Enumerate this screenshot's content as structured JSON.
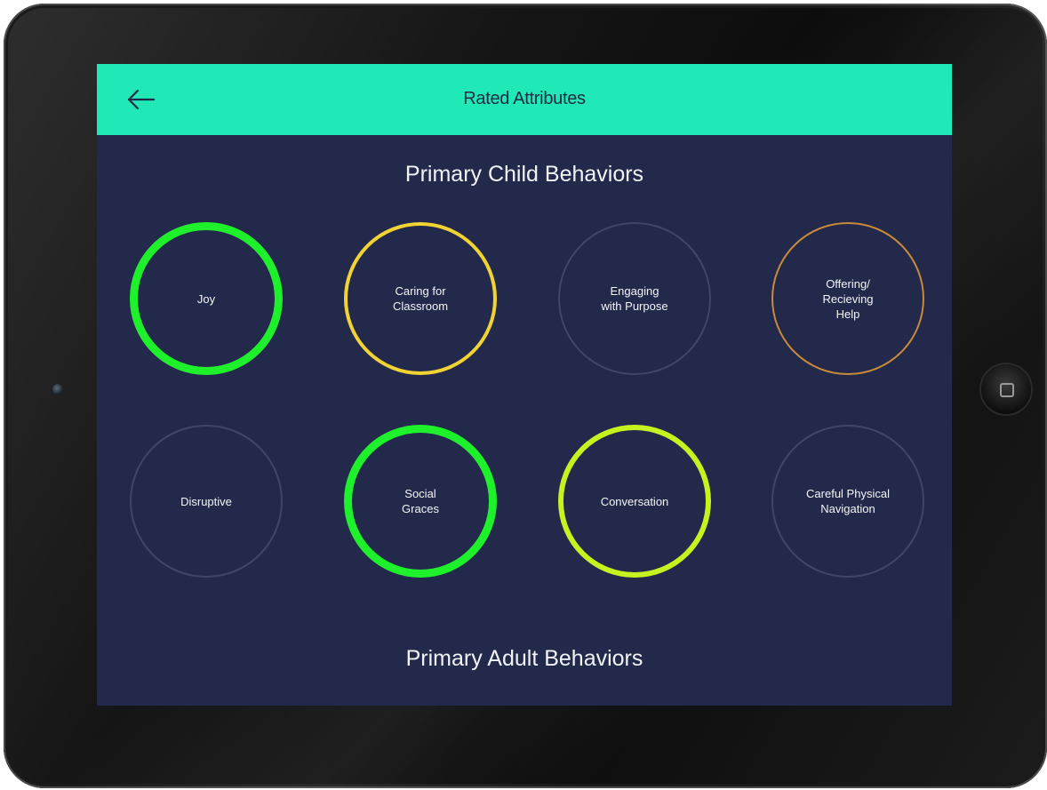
{
  "header": {
    "title": "Rated Attributes",
    "back_icon": "arrow-left-icon",
    "background": "#20e8b6"
  },
  "sections": {
    "child_title": "Primary Child Behaviors",
    "adult_title": "Primary Adult Behaviors"
  },
  "attributes": [
    {
      "name": "attribute-joy",
      "label": "Joy",
      "ring_color": "#1ff02c",
      "ring_width": "thick"
    },
    {
      "name": "attribute-caring-for-classroom",
      "label": "Caring for\nClassroom",
      "ring_color": "#f1d334",
      "ring_width": "medium"
    },
    {
      "name": "attribute-engaging-with-purpose",
      "label": "Engaging\nwith Purpose",
      "ring_color": "#3f4769",
      "ring_width": "thin"
    },
    {
      "name": "attribute-offering-recieving-help",
      "label": "Offering/\nRecieving\nHelp",
      "ring_color": "#c98a3a",
      "ring_width": "thin"
    },
    {
      "name": "attribute-disruptive",
      "label": "Disruptive",
      "ring_color": "#3f4769",
      "ring_width": "thin"
    },
    {
      "name": "attribute-social-graces",
      "label": "Social\nGraces",
      "ring_color": "#1ff02c",
      "ring_width": "thick"
    },
    {
      "name": "attribute-conversation",
      "label": "Conversation",
      "ring_color": "#c6f320",
      "ring_width": "medium-thick"
    },
    {
      "name": "attribute-careful-physical-navigation",
      "label": "Careful Physical\nNavigation",
      "ring_color": "#3f4769",
      "ring_width": "thin"
    }
  ],
  "colors": {
    "screen_background": "#23294a",
    "text": "#f2f3f7"
  }
}
